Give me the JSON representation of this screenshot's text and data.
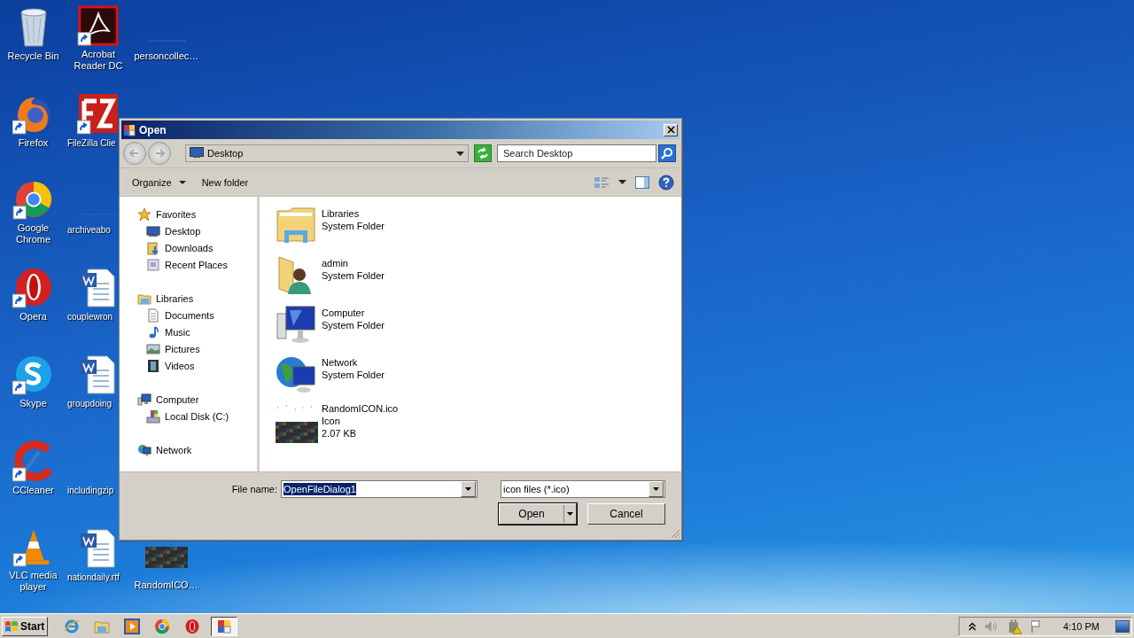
{
  "desktop": {
    "columns": [
      [
        {
          "label": "Recycle Bin",
          "kind": "recycle",
          "shortcut": false
        },
        {
          "label": "Firefox",
          "kind": "firefox",
          "shortcut": true
        },
        {
          "label": "Google Chrome",
          "kind": "chrome",
          "shortcut": true
        },
        {
          "label": "Opera",
          "kind": "opera",
          "shortcut": true
        },
        {
          "label": "Skype",
          "kind": "skype",
          "shortcut": true
        },
        {
          "label": "CCleaner",
          "kind": "ccleaner",
          "shortcut": true
        },
        {
          "label": "VLC media player",
          "kind": "vlc",
          "shortcut": true
        }
      ],
      [
        {
          "label": "Acrobat Reader DC",
          "kind": "acrobat",
          "shortcut": true
        },
        {
          "label": "FileZilla Clie",
          "kind": "filezilla",
          "shortcut": true
        },
        {
          "label": "archiveabo",
          "kind": "blank",
          "shortcut": false
        },
        {
          "label": "couplewron",
          "kind": "word",
          "shortcut": false
        },
        {
          "label": "groupdoing",
          "kind": "word",
          "shortcut": false
        },
        {
          "label": "includingzip",
          "kind": "blank",
          "shortcut": false
        },
        {
          "label": "nationdaily.rtf",
          "kind": "word",
          "shortcut": false
        }
      ],
      [
        {
          "label": "personcollec…",
          "kind": "blank",
          "shortcut": false
        },
        {
          "label": "RandomICO…",
          "kind": "noise",
          "shortcut": false
        }
      ]
    ]
  },
  "dialog": {
    "title": "Open",
    "address": "Desktop",
    "search": {
      "placeholder": "Search Desktop"
    },
    "toolbar": [
      "Organize",
      "New folder"
    ],
    "nav_tree": [
      {
        "label": "Favorites",
        "kind": "star",
        "children": [
          {
            "label": "Desktop",
            "kind": "desktop"
          },
          {
            "label": "Downloads",
            "kind": "downloads"
          },
          {
            "label": "Recent Places",
            "kind": "recent"
          }
        ]
      },
      {
        "label": "Libraries",
        "kind": "libraries",
        "children": [
          {
            "label": "Documents",
            "kind": "documents"
          },
          {
            "label": "Music",
            "kind": "music"
          },
          {
            "label": "Pictures",
            "kind": "pictures"
          },
          {
            "label": "Videos",
            "kind": "videos"
          }
        ]
      },
      {
        "label": "Computer",
        "kind": "computer",
        "children": [
          {
            "label": "Local Disk (C:)",
            "kind": "disk"
          }
        ]
      },
      {
        "label": "Network",
        "kind": "network"
      }
    ],
    "files": [
      {
        "kind": "libraries",
        "lines": [
          "Libraries",
          "System Folder"
        ]
      },
      {
        "kind": "user",
        "lines": [
          "admin",
          "System Folder"
        ]
      },
      {
        "kind": "computer",
        "lines": [
          "Computer",
          "System Folder"
        ]
      },
      {
        "kind": "network",
        "lines": [
          "Network",
          "System Folder"
        ]
      },
      {
        "kind": "noise",
        "lines": [
          "RandomICON.ico",
          "Icon",
          "2.07 KB"
        ]
      }
    ],
    "file_name": {
      "label": "File name:",
      "value": "OpenFileDialog1",
      "text_selected": true
    },
    "file_type": "icon files (*.ico)",
    "buttons": [
      {
        "label": "Open",
        "kind": "split"
      },
      {
        "label": "Cancel",
        "kind": "plain"
      }
    ]
  },
  "taskbar": {
    "start": "Start",
    "items": [
      {
        "kind": "ie",
        "selected": false
      },
      {
        "kind": "explorer",
        "selected": false
      },
      {
        "kind": "media",
        "selected": false
      },
      {
        "kind": "chrome",
        "selected": false
      },
      {
        "kind": "opera",
        "selected": false
      },
      {
        "kind": "dialog",
        "selected": true
      }
    ],
    "clock": "4:10 PM"
  }
}
